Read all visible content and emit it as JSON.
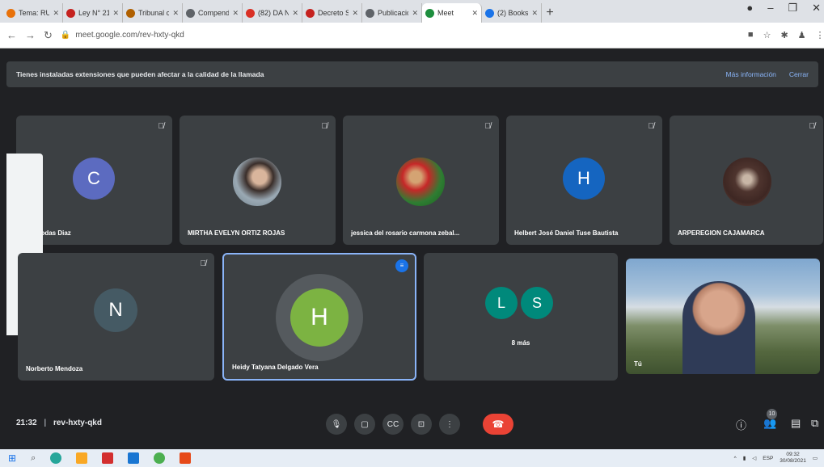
{
  "browser": {
    "tabs": [
      {
        "label": "Tema: RUI",
        "color": "#e8710a"
      },
      {
        "label": "Ley N° 211",
        "color": "#c5221f"
      },
      {
        "label": "Tribunal co",
        "color": "#b06000"
      },
      {
        "label": "Compendi",
        "color": "#5f6368"
      },
      {
        "label": "(82) DA N",
        "color": "#d93025"
      },
      {
        "label": "Decreto S",
        "color": "#c5221f"
      },
      {
        "label": "Publicació",
        "color": "#5f6368"
      },
      {
        "label": "Meet",
        "color": "#1e8e3e",
        "active": true
      },
      {
        "label": "(2) Books",
        "color": "#1a73e8"
      }
    ],
    "url": "meet.google.com/rev-hxty-qkd"
  },
  "banner": {
    "message": "Tienes instaladas extensiones que pueden afectar a la calidad de la llamada",
    "more_info": "Más información",
    "close": "Cerrar"
  },
  "participants": [
    {
      "name": "…s Rodas Diaz",
      "initial": "C",
      "color": "#5c6bc0"
    },
    {
      "name": "MIRTHA EVELYN ORTIZ ROJAS",
      "initial": "",
      "color": "#7d8c94"
    },
    {
      "name": "jessica del rosario carmona zebal...",
      "initial": "",
      "color": "#6a8a4a"
    },
    {
      "name": "Helbert José Daniel Tuse Bautista",
      "initial": "H",
      "color": "#1565c0"
    },
    {
      "name": "ARPEREGION CAJAMARCA",
      "initial": "",
      "color": "#5a4a3a"
    },
    {
      "name": "Norberto Mendoza",
      "initial": "N",
      "color": "#455a64"
    },
    {
      "name": "Heidy Tatyana Delgado Vera",
      "initial": "H",
      "color": "#7cb342"
    },
    {
      "name": "8 más",
      "initial_1": "L",
      "initial_2": "S",
      "color": "#00897b"
    },
    {
      "name": "Tú"
    }
  ],
  "bottom": {
    "time": "21:32",
    "meeting_code": "rev-hxty-qkd",
    "people_count": "10"
  },
  "taskbar": {
    "lang": "ESP",
    "clock_time": "09:32",
    "clock_date": "30/08/2021"
  }
}
